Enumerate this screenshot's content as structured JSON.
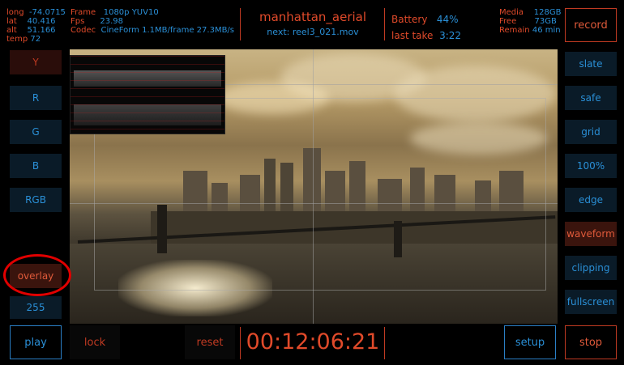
{
  "gps": {
    "long_label": "long",
    "long_value": "-74.0715",
    "lat_label": "lat",
    "lat_value": "40.416",
    "alt_label": "alt",
    "alt_value": "51.166",
    "temp_label": "temp",
    "temp_value": "72"
  },
  "clip": {
    "frame_label": "Frame",
    "frame_value": "1080p YUV10",
    "fps_label": "Fps",
    "fps_value": "23.98",
    "codec_label": "Codec",
    "codec_value": "CineForm 1.1MB/frame 27.3MB/s"
  },
  "title": {
    "name": "manhattan_aerial",
    "next": "next: reel3_021.mov"
  },
  "battery": {
    "label": "Battery",
    "value": "44%",
    "last_take_label": "last take",
    "last_take_value": "3:22"
  },
  "media": {
    "media_label": "Media",
    "media_value": "128GB",
    "free_label": "Free",
    "free_value": "73GB",
    "remain_label": "Remain",
    "remain_value": "46 min"
  },
  "left_buttons": {
    "y": "Y",
    "r": "R",
    "g": "G",
    "b": "B",
    "rgb": "RGB",
    "overlay": "overlay",
    "level": "255"
  },
  "right_buttons": {
    "record": "record",
    "slate": "slate",
    "safe": "safe",
    "grid": "grid",
    "zoom": "100%",
    "edge": "edge",
    "waveform": "waveform",
    "clipping": "clipping",
    "fullscreen": "fullscreen"
  },
  "bottom": {
    "play": "play",
    "lock": "lock",
    "reset": "reset",
    "timecode": "00:12:06:21",
    "setup": "setup",
    "stop": "stop"
  },
  "colors": {
    "accent_blue": "#2a8fd6",
    "accent_red": "#e04a2a",
    "annotation": "#e00000"
  }
}
